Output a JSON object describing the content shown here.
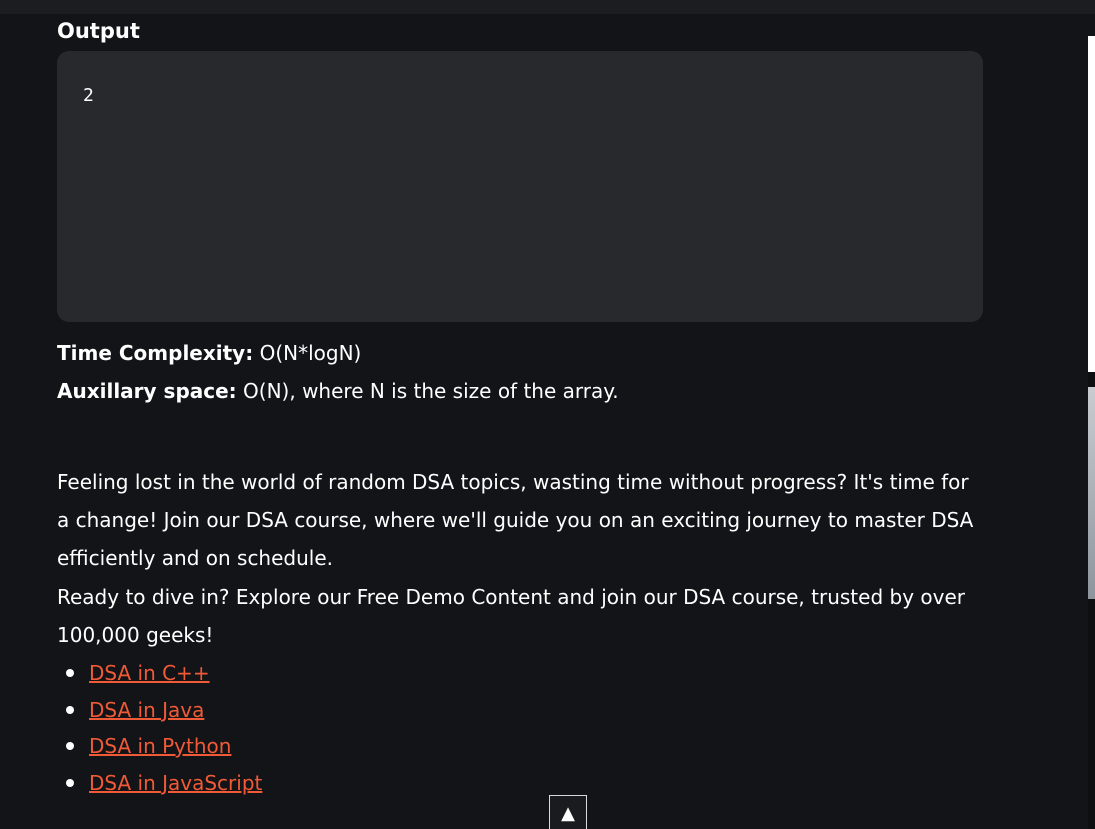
{
  "output": {
    "heading": "Output",
    "value": "2"
  },
  "complexity": {
    "time_label": "Time Complexity:",
    "time_value": " O(N*logN)",
    "space_label": "Auxillary space:",
    "space_value": " O(N), where N is the size of the array."
  },
  "promo": {
    "paragraph_1": "Feeling lost in the world of random DSA topics, wasting time without progress? It's time for a change! Join our DSA course, where we'll guide you on an exciting journey to master DSA efficiently and on schedule.",
    "paragraph_2": "Ready to dive in? Explore our Free Demo Content and join our DSA course, trusted by over 100,000 geeks!",
    "links": [
      {
        "label": "DSA in C++"
      },
      {
        "label": "DSA in Java"
      },
      {
        "label": "DSA in Python"
      },
      {
        "label": "DSA in JavaScript"
      }
    ]
  },
  "scroll_top": {
    "icon": "up-triangle-icon",
    "glyph": "▲"
  },
  "colors": {
    "background": "#131417",
    "code_box": "#28292c",
    "link": "#f05a37"
  }
}
